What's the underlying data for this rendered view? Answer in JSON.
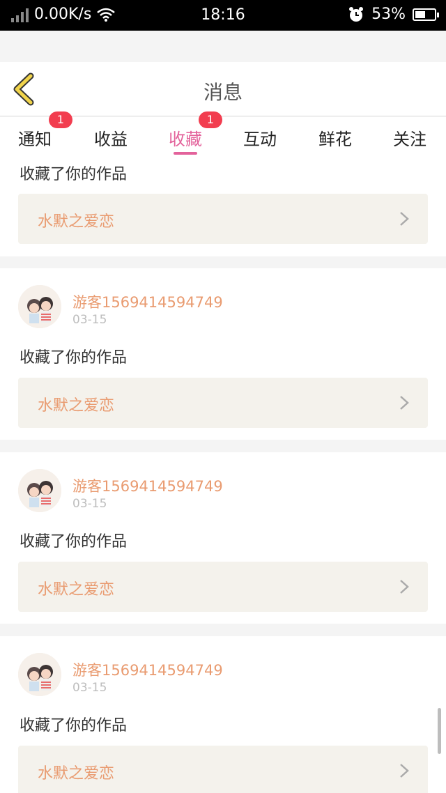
{
  "status_bar": {
    "network_speed": "0.00K/s",
    "time": "18:16",
    "battery_percent": "53%",
    "battery_level": 0.53
  },
  "header": {
    "title": "消息"
  },
  "tabs": [
    {
      "label": "通知",
      "badge": "1"
    },
    {
      "label": "收益",
      "badge": ""
    },
    {
      "label": "收藏",
      "badge": "1",
      "active": true
    },
    {
      "label": "互动",
      "badge": ""
    },
    {
      "label": "鲜花",
      "badge": ""
    },
    {
      "label": "关注",
      "badge": ""
    }
  ],
  "feed": [
    {
      "user": "",
      "date": "",
      "action": "收藏了你的作品",
      "work": "水默之爱恋"
    },
    {
      "user": "游客1569414594749",
      "date": "03-15",
      "action": "收藏了你的作品",
      "work": "水默之爱恋"
    },
    {
      "user": "游客1569414594749",
      "date": "03-15",
      "action": "收藏了你的作品",
      "work": "水默之爱恋"
    },
    {
      "user": "游客1569414594749",
      "date": "03-15",
      "action": "收藏了你的作品",
      "work": "水默之爱恋"
    }
  ],
  "colors": {
    "accent_pink": "#e3629b",
    "username_orange": "#e99b70",
    "badge_red": "#f23d4f",
    "back_arrow_yellow": "#f1d44b"
  },
  "icons": {
    "back": "back-chevron-icon",
    "item_arrow": "chevron-right-icon",
    "alarm": "alarm-icon",
    "wifi": "wifi-icon",
    "battery": "battery-icon",
    "signal": "signal-icon"
  }
}
